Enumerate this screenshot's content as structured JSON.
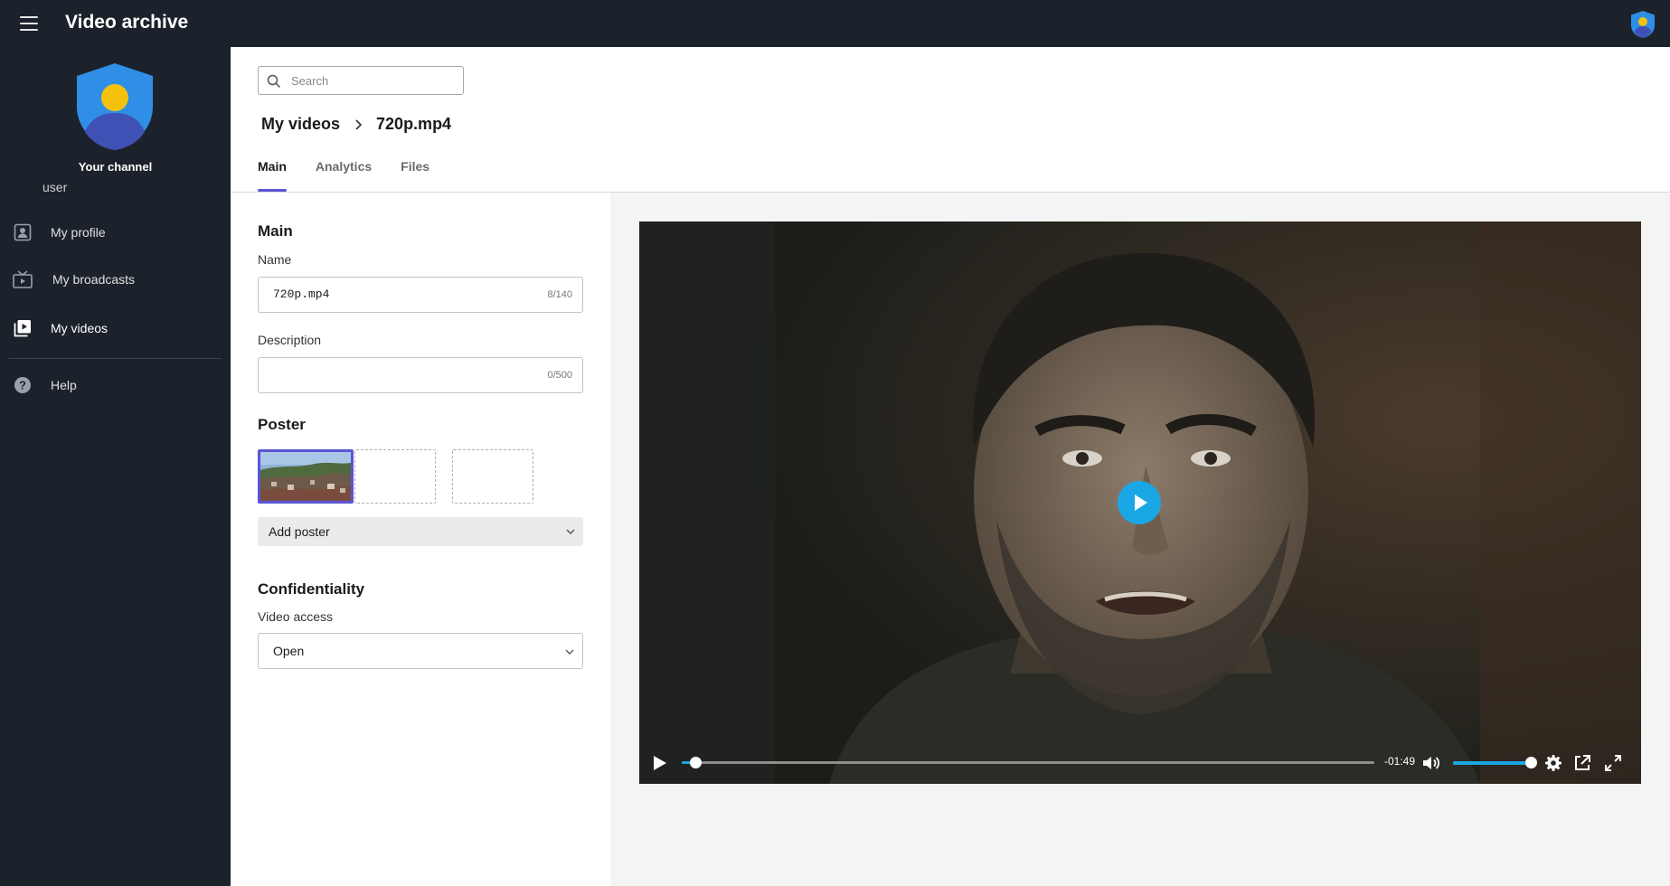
{
  "app": {
    "title": "Video archive"
  },
  "sidebar": {
    "channel_label": "Your channel",
    "username": "user",
    "items": [
      {
        "label": "My profile",
        "icon": "profile-icon"
      },
      {
        "label": "My broadcasts",
        "icon": "broadcast-icon"
      },
      {
        "label": "My videos",
        "icon": "video-library-icon",
        "active": true
      },
      {
        "label": "Help",
        "icon": "help-icon"
      }
    ]
  },
  "search": {
    "placeholder": "Search",
    "value": ""
  },
  "breadcrumb": {
    "parent": "My videos",
    "current": "720p.mp4"
  },
  "tabs": [
    {
      "label": "Main",
      "active": true
    },
    {
      "label": "Analytics"
    },
    {
      "label": "Files"
    }
  ],
  "form": {
    "main_title": "Main",
    "name_label": "Name",
    "name_value": "720p.mp4",
    "name_counter": "8/140",
    "description_label": "Description",
    "description_value": "",
    "description_counter": "0/500",
    "poster_title": "Poster",
    "add_poster_label": "Add poster",
    "confidentiality_title": "Confidentiality",
    "access_label": "Video access",
    "access_value": "Open"
  },
  "player": {
    "time_remaining": "-01:49",
    "progress_fraction": 0.02,
    "volume_fraction": 1.0
  },
  "colors": {
    "chrome_bg": "#1c222b",
    "accent": "#5a55d6",
    "player_accent": "#1aa7e6"
  }
}
